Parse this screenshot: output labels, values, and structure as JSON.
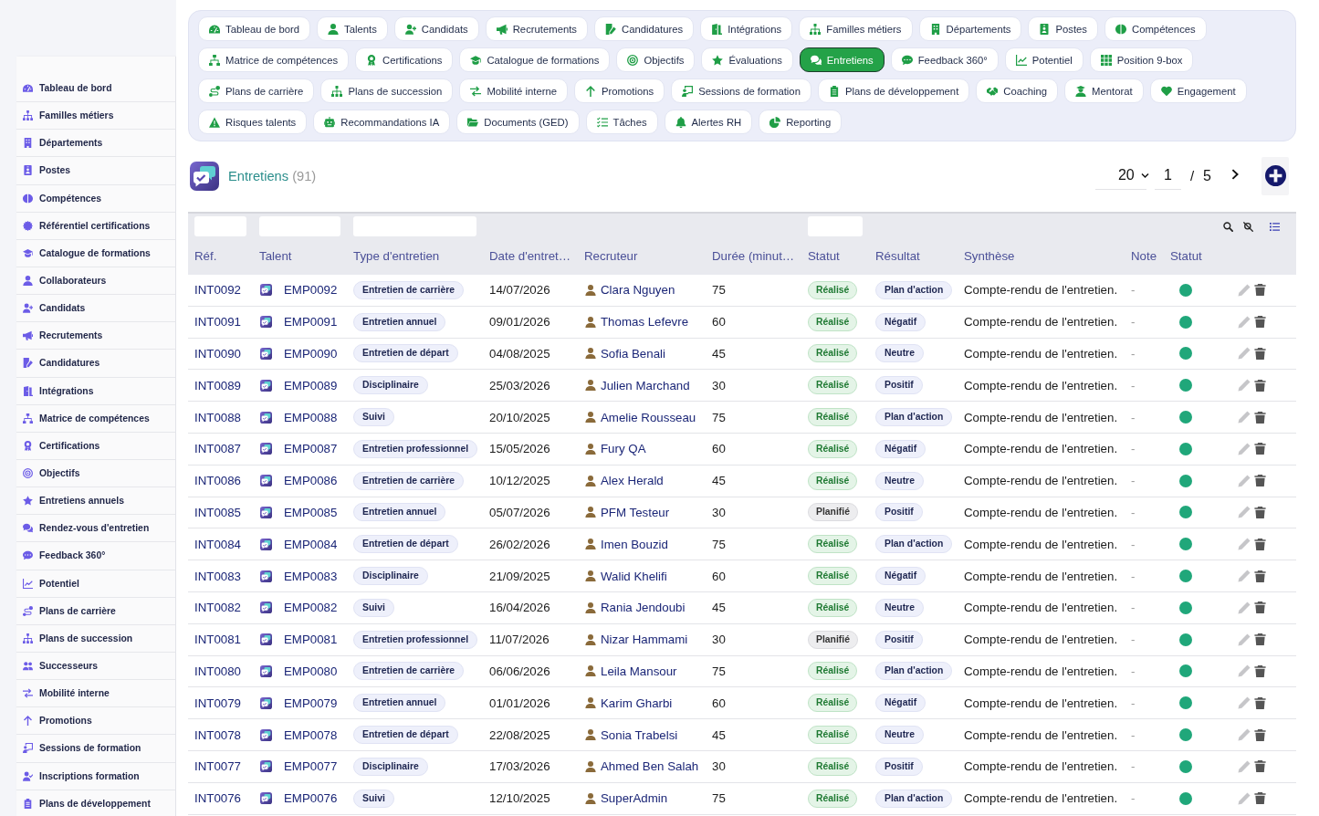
{
  "sidebar": {
    "items": [
      {
        "label": "Tableau de bord"
      },
      {
        "label": "Familles métiers"
      },
      {
        "label": "Départements"
      },
      {
        "label": "Postes"
      },
      {
        "label": "Compétences"
      },
      {
        "label": "Référentiel certifications"
      },
      {
        "label": "Catalogue de formations"
      },
      {
        "label": "Collaborateurs"
      },
      {
        "label": "Candidats"
      },
      {
        "label": "Recrutements"
      },
      {
        "label": "Candidatures"
      },
      {
        "label": "Intégrations"
      },
      {
        "label": "Matrice de compétences"
      },
      {
        "label": "Certifications"
      },
      {
        "label": "Objectifs"
      },
      {
        "label": "Entretiens annuels"
      },
      {
        "label": "Rendez-vous d'entretien"
      },
      {
        "label": "Feedback 360°"
      },
      {
        "label": "Potentiel"
      },
      {
        "label": "Plans de carrière"
      },
      {
        "label": "Plans de succession"
      },
      {
        "label": "Successeurs"
      },
      {
        "label": "Mobilité interne"
      },
      {
        "label": "Promotions"
      },
      {
        "label": "Sessions de formation"
      },
      {
        "label": "Inscriptions formation"
      },
      {
        "label": "Plans de développement"
      }
    ]
  },
  "tabs": [
    {
      "label": "Tableau de bord",
      "selected": false
    },
    {
      "label": "Talents",
      "selected": false
    },
    {
      "label": "Candidats",
      "selected": false
    },
    {
      "label": "Recrutements",
      "selected": false
    },
    {
      "label": "Candidatures",
      "selected": false
    },
    {
      "label": "Intégrations",
      "selected": false
    },
    {
      "label": "Familles métiers",
      "selected": false
    },
    {
      "label": "Départements",
      "selected": false
    },
    {
      "label": "Postes",
      "selected": false
    },
    {
      "label": "Compétences",
      "selected": false
    },
    {
      "label": "Matrice de compétences",
      "selected": false
    },
    {
      "label": "Certifications",
      "selected": false
    },
    {
      "label": "Catalogue de formations",
      "selected": false
    },
    {
      "label": "Objectifs",
      "selected": false
    },
    {
      "label": "Évaluations",
      "selected": false
    },
    {
      "label": "Entretiens",
      "selected": true
    },
    {
      "label": "Feedback 360°",
      "selected": false
    },
    {
      "label": "Potentiel",
      "selected": false
    },
    {
      "label": "Position 9-box",
      "selected": false
    },
    {
      "label": "Plans de carrière",
      "selected": false
    },
    {
      "label": "Plans de succession",
      "selected": false
    },
    {
      "label": "Mobilité interne",
      "selected": false
    },
    {
      "label": "Promotions",
      "selected": false
    },
    {
      "label": "Sessions de formation",
      "selected": false
    },
    {
      "label": "Plans de développement",
      "selected": false
    },
    {
      "label": "Coaching",
      "selected": false
    },
    {
      "label": "Mentorat",
      "selected": false
    },
    {
      "label": "Engagement",
      "selected": false
    },
    {
      "label": "Risques talents",
      "selected": false
    },
    {
      "label": "Recommandations IA",
      "selected": false
    },
    {
      "label": "Documents (GED)",
      "selected": false
    },
    {
      "label": "Tâches",
      "selected": false
    },
    {
      "label": "Alertes RH",
      "selected": false
    },
    {
      "label": "Reporting",
      "selected": false
    }
  ],
  "page_header": {
    "title": "Entretiens",
    "count": "(91)"
  },
  "pagination": {
    "page_size": "20",
    "page": "1",
    "separator": "/",
    "total_pages": "5"
  },
  "table": {
    "columns": [
      {
        "label": "Réf.",
        "filter": true
      },
      {
        "label": "Talent",
        "filter": true
      },
      {
        "label": "Type d'entretien",
        "filter": true
      },
      {
        "label": "Date d'entret…",
        "filter": false
      },
      {
        "label": "Recruteur",
        "filter": false
      },
      {
        "label": "Durée (minut…",
        "filter": false
      },
      {
        "label": "Statut",
        "filter": true
      },
      {
        "label": "Résultat",
        "filter": false
      },
      {
        "label": "Synthèse",
        "filter": false
      },
      {
        "label": "Note",
        "filter": false
      },
      {
        "label": "Statut",
        "filter": false
      }
    ],
    "rows": [
      {
        "ref": "INT0092",
        "talent": "EMP0092",
        "type": "Entretien de carrière",
        "date": "14/07/2026",
        "recruiter": "Clara Nguyen",
        "duration": "75",
        "status": {
          "label": "Réalisé",
          "kind": "done"
        },
        "result": "Plan d'action",
        "summary": "Compte-rendu de l'entretien.",
        "note": "-",
        "active": true
      },
      {
        "ref": "INT0091",
        "talent": "EMP0091",
        "type": "Entretien annuel",
        "date": "09/01/2026",
        "recruiter": "Thomas Lefevre",
        "duration": "60",
        "status": {
          "label": "Réalisé",
          "kind": "done"
        },
        "result": "Négatif",
        "summary": "Compte-rendu de l'entretien.",
        "note": "-",
        "active": true
      },
      {
        "ref": "INT0090",
        "talent": "EMP0090",
        "type": "Entretien de départ",
        "date": "04/08/2025",
        "recruiter": "Sofia Benali",
        "duration": "45",
        "status": {
          "label": "Réalisé",
          "kind": "done"
        },
        "result": "Neutre",
        "summary": "Compte-rendu de l'entretien.",
        "note": "-",
        "active": true
      },
      {
        "ref": "INT0089",
        "talent": "EMP0089",
        "type": "Disciplinaire",
        "date": "25/03/2026",
        "recruiter": "Julien Marchand",
        "duration": "30",
        "status": {
          "label": "Réalisé",
          "kind": "done"
        },
        "result": "Positif",
        "summary": "Compte-rendu de l'entretien.",
        "note": "-",
        "active": true
      },
      {
        "ref": "INT0088",
        "talent": "EMP0088",
        "type": "Suivi",
        "date": "20/10/2025",
        "recruiter": "Amelie Rousseau",
        "duration": "75",
        "status": {
          "label": "Réalisé",
          "kind": "done"
        },
        "result": "Plan d'action",
        "summary": "Compte-rendu de l'entretien.",
        "note": "-",
        "active": true
      },
      {
        "ref": "INT0087",
        "talent": "EMP0087",
        "type": "Entretien professionnel",
        "date": "15/05/2026",
        "recruiter": "Fury QA",
        "duration": "60",
        "status": {
          "label": "Réalisé",
          "kind": "done"
        },
        "result": "Négatif",
        "summary": "Compte-rendu de l'entretien.",
        "note": "-",
        "active": true
      },
      {
        "ref": "INT0086",
        "talent": "EMP0086",
        "type": "Entretien de carrière",
        "date": "10/12/2025",
        "recruiter": "Alex Herald",
        "duration": "45",
        "status": {
          "label": "Réalisé",
          "kind": "done"
        },
        "result": "Neutre",
        "summary": "Compte-rendu de l'entretien.",
        "note": "-",
        "active": true
      },
      {
        "ref": "INT0085",
        "talent": "EMP0085",
        "type": "Entretien annuel",
        "date": "05/07/2026",
        "recruiter": "PFM Testeur",
        "duration": "30",
        "status": {
          "label": "Planifié",
          "kind": "planned"
        },
        "result": "Positif",
        "summary": "Compte-rendu de l'entretien.",
        "note": "-",
        "active": true
      },
      {
        "ref": "INT0084",
        "talent": "EMP0084",
        "type": "Entretien de départ",
        "date": "26/02/2026",
        "recruiter": "Imen Bouzid",
        "duration": "75",
        "status": {
          "label": "Réalisé",
          "kind": "done"
        },
        "result": "Plan d'action",
        "summary": "Compte-rendu de l'entretien.",
        "note": "-",
        "active": true
      },
      {
        "ref": "INT0083",
        "talent": "EMP0083",
        "type": "Disciplinaire",
        "date": "21/09/2025",
        "recruiter": "Walid Khelifi",
        "duration": "60",
        "status": {
          "label": "Réalisé",
          "kind": "done"
        },
        "result": "Négatif",
        "summary": "Compte-rendu de l'entretien.",
        "note": "-",
        "active": true
      },
      {
        "ref": "INT0082",
        "talent": "EMP0082",
        "type": "Suivi",
        "date": "16/04/2026",
        "recruiter": "Rania Jendoubi",
        "duration": "45",
        "status": {
          "label": "Réalisé",
          "kind": "done"
        },
        "result": "Neutre",
        "summary": "Compte-rendu de l'entretien.",
        "note": "-",
        "active": true
      },
      {
        "ref": "INT0081",
        "talent": "EMP0081",
        "type": "Entretien professionnel",
        "date": "11/07/2026",
        "recruiter": "Nizar Hammami",
        "duration": "30",
        "status": {
          "label": "Planifié",
          "kind": "planned"
        },
        "result": "Positif",
        "summary": "Compte-rendu de l'entretien.",
        "note": "-",
        "active": true
      },
      {
        "ref": "INT0080",
        "talent": "EMP0080",
        "type": "Entretien de carrière",
        "date": "06/06/2026",
        "recruiter": "Leila Mansour",
        "duration": "75",
        "status": {
          "label": "Réalisé",
          "kind": "done"
        },
        "result": "Plan d'action",
        "summary": "Compte-rendu de l'entretien.",
        "note": "-",
        "active": true
      },
      {
        "ref": "INT0079",
        "talent": "EMP0079",
        "type": "Entretien annuel",
        "date": "01/01/2026",
        "recruiter": "Karim Gharbi",
        "duration": "60",
        "status": {
          "label": "Réalisé",
          "kind": "done"
        },
        "result": "Négatif",
        "summary": "Compte-rendu de l'entretien.",
        "note": "-",
        "active": true
      },
      {
        "ref": "INT0078",
        "talent": "EMP0078",
        "type": "Entretien de départ",
        "date": "22/08/2025",
        "recruiter": "Sonia Trabelsi",
        "duration": "45",
        "status": {
          "label": "Réalisé",
          "kind": "done"
        },
        "result": "Neutre",
        "summary": "Compte-rendu de l'entretien.",
        "note": "-",
        "active": true
      },
      {
        "ref": "INT0077",
        "talent": "EMP0077",
        "type": "Disciplinaire",
        "date": "17/03/2026",
        "recruiter": "Ahmed Ben Salah",
        "duration": "30",
        "status": {
          "label": "Réalisé",
          "kind": "done"
        },
        "result": "Positif",
        "summary": "Compte-rendu de l'entretien.",
        "note": "-",
        "active": true
      },
      {
        "ref": "INT0076",
        "talent": "EMP0076",
        "type": "Suivi",
        "date": "12/10/2025",
        "recruiter": "SuperAdmin",
        "duration": "75",
        "status": {
          "label": "Réalisé",
          "kind": "done"
        },
        "result": "Plan d'action",
        "summary": "Compte-rendu de l'entretien.",
        "note": "-",
        "active": true
      }
    ]
  }
}
